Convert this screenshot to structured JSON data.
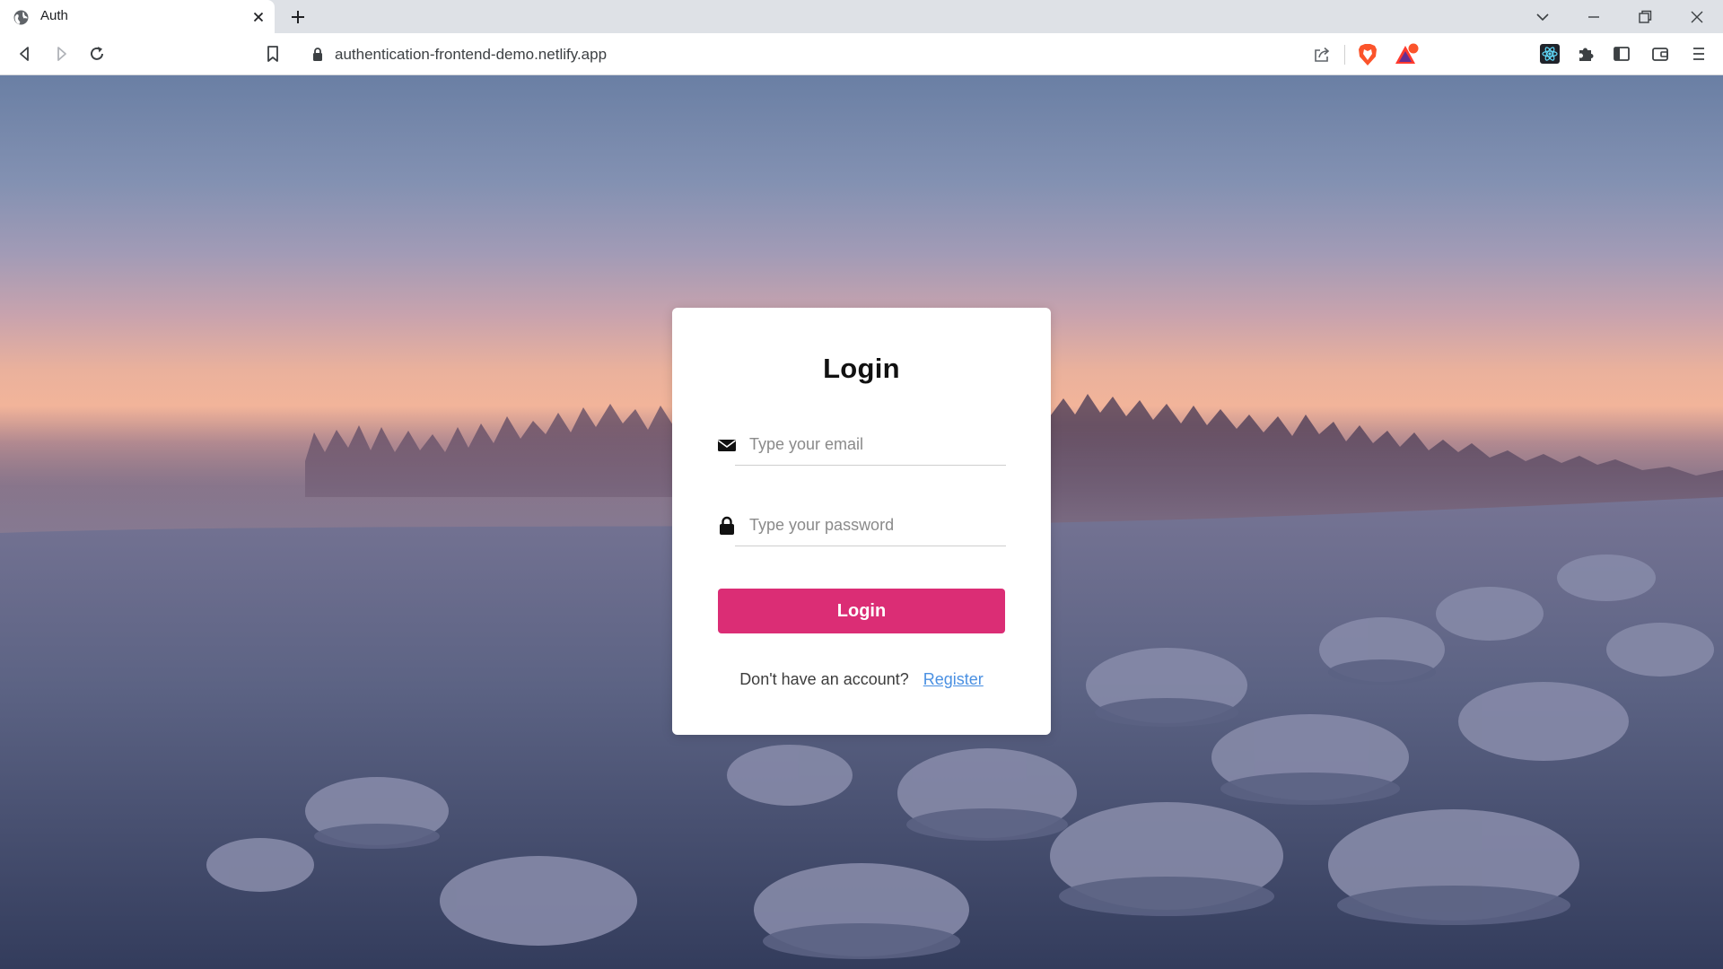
{
  "browser": {
    "tab": {
      "title": "Auth"
    },
    "address": {
      "url": "authentication-frontend-demo.netlify.app"
    },
    "rewards_badge": "",
    "icons": {
      "back": "back-icon",
      "forward": "forward-icon",
      "reload": "reload-icon",
      "bookmark": "bookmark-icon",
      "lock": "lock-icon",
      "share": "share-icon",
      "brave": "brave-shields-icon",
      "rewards": "brave-rewards-icon",
      "react": "react-devtools-icon",
      "extensions": "puzzle-icon",
      "sidebar": "sidebar-icon",
      "wallet": "wallet-icon",
      "menu": "hamburger-menu-icon"
    }
  },
  "login": {
    "title": "Login",
    "email": {
      "placeholder": "Type your email",
      "value": ""
    },
    "password": {
      "placeholder": "Type your password",
      "value": ""
    },
    "submit_label": "Login",
    "signup_prompt": "Don't have an account?",
    "register_label": "Register"
  },
  "colors": {
    "accent": "#db2d75",
    "link": "#4a90e2",
    "card": "#ffffff"
  }
}
